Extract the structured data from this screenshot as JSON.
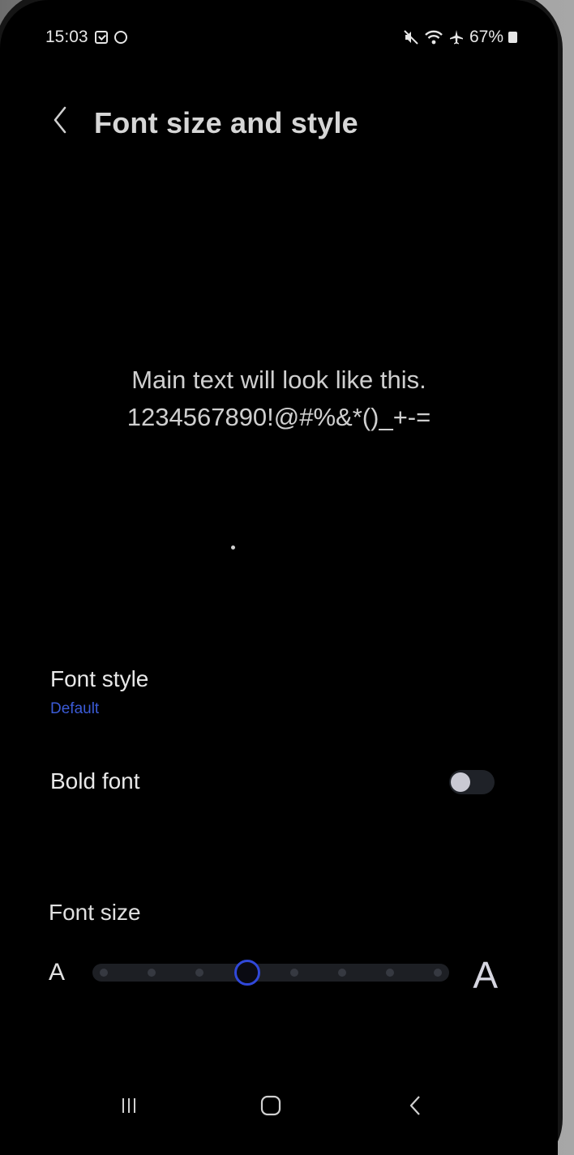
{
  "status_bar": {
    "time": "15:03",
    "battery": "67%",
    "icons": [
      "notification-box-icon",
      "sync-circle-icon",
      "mute-icon",
      "wifi-icon",
      "airplane-icon",
      "battery-icon"
    ]
  },
  "header": {
    "title": "Font size and style",
    "back_icon": "chevron-left-icon"
  },
  "preview": {
    "line1": "Main text will look like this.",
    "line2": "1234567890!@#%&*()_+-="
  },
  "font_style": {
    "label": "Font style",
    "value": "Default"
  },
  "bold_font": {
    "label": "Bold font",
    "enabled": false
  },
  "font_size": {
    "label": "Font size",
    "small_glyph": "A",
    "large_glyph": "A",
    "steps": 8,
    "selected_step": 4
  },
  "nav_bar": {
    "items": [
      "recents-icon",
      "home-icon",
      "back-icon"
    ]
  },
  "colors": {
    "background": "#000000",
    "accent": "#3048d9",
    "subtitle": "#3b5bd6",
    "text": "#e8e8e8"
  }
}
